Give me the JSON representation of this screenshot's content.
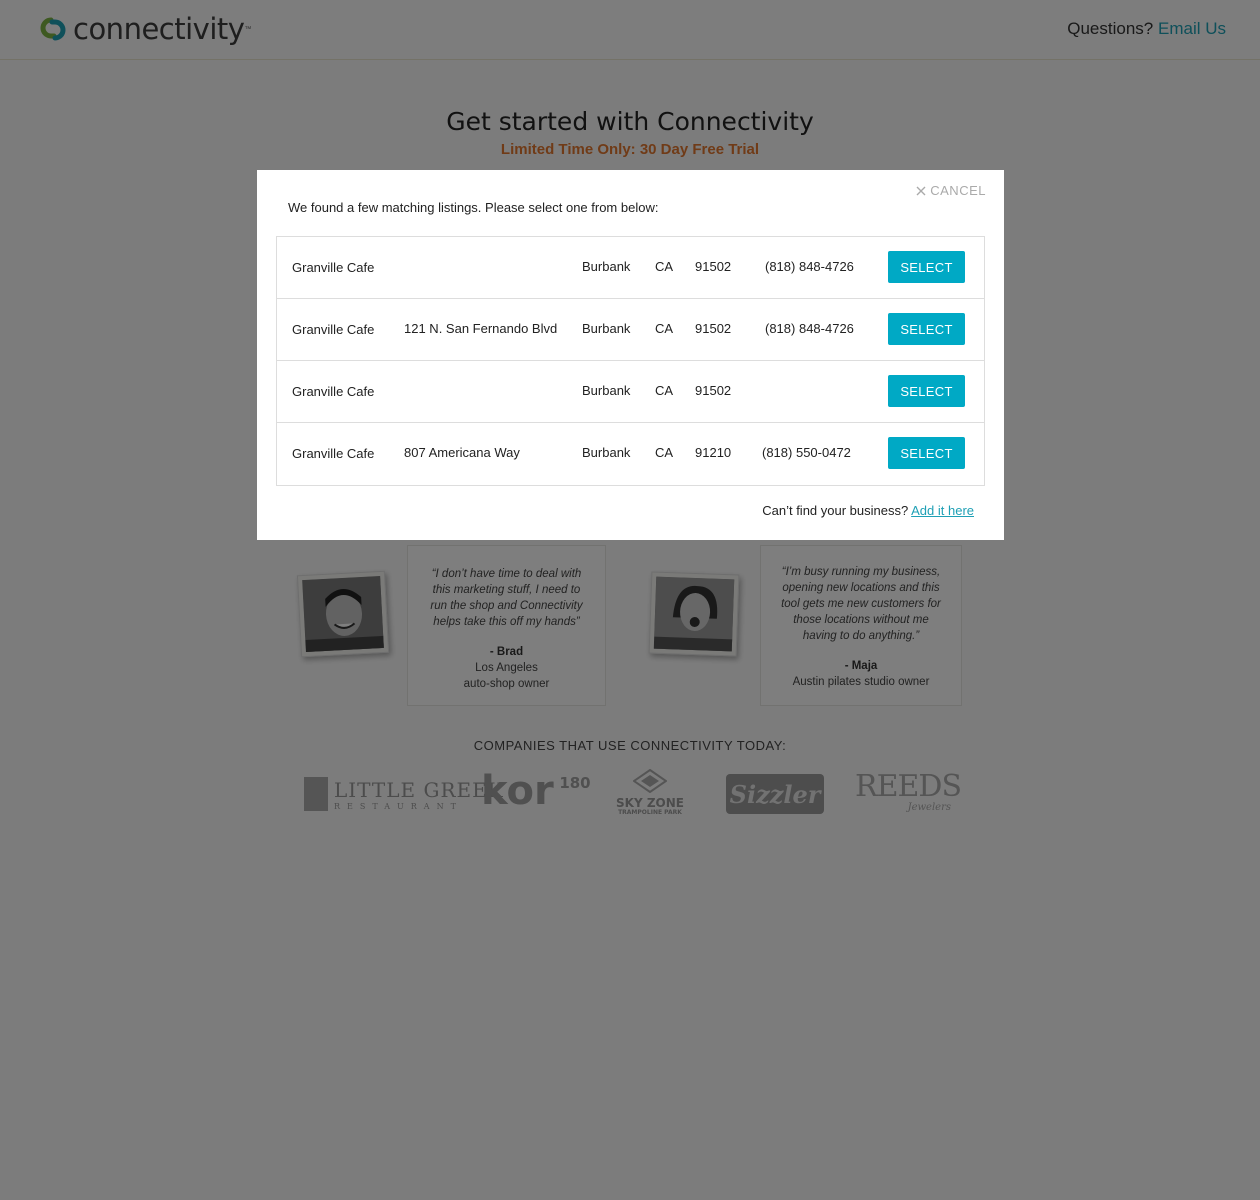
{
  "header": {
    "logo_text": "connectivity",
    "logo_tm": "™",
    "questions_label": "Questions?",
    "email_link": "Email Us"
  },
  "hero": {
    "title": "Get started with Connectivity",
    "subtitle": "Limited Time Only: 30 Day Free Trial"
  },
  "testimonials": [
    {
      "quote": "“I don’t have time to deal with this marketing stuff, I need to run the shop and Connectivity helps take this off my hands”",
      "name": "- Brad",
      "desc1": "Los Angeles",
      "desc2": "auto-shop owner"
    },
    {
      "quote": "“I’m busy running my business, opening new locations and this tool gets me new customers for those locations without me having to do anything.”",
      "name": "- Maja",
      "desc1": "Austin pilates studio owner",
      "desc2": ""
    }
  ],
  "companies": {
    "title": "COMPANIES THAT USE CONNECTIVITY TODAY:",
    "logos": [
      "LITTLE GREEK",
      "RESTAURANT",
      "kor",
      "180",
      "SKY ZONE",
      "TRAMPOLINE PARK",
      "Sizzler",
      "REEDS",
      "Jewelers"
    ]
  },
  "modal": {
    "cancel_label": "CANCEL",
    "intro": "We found a few matching listings. Please select one from below:",
    "select_label": "SELECT",
    "listings": [
      {
        "name": "Granville Cafe",
        "address": "",
        "city": "Burbank",
        "state": "CA",
        "zip": "91502",
        "phone": "(818) 848-4726"
      },
      {
        "name": "Granville Cafe",
        "address": "121 N. San Fernando Blvd",
        "city": "Burbank",
        "state": "CA",
        "zip": "91502",
        "phone": "(818) 848-4726"
      },
      {
        "name": "Granville Cafe",
        "address": "",
        "city": "Burbank",
        "state": "CA",
        "zip": "91502",
        "phone": ""
      },
      {
        "name": "Granville Cafe",
        "address": "807 Americana Way",
        "city": "Burbank",
        "state": "CA",
        "zip": "91210",
        "phone": "(818) 550-0472"
      }
    ],
    "cant_find": "Can’t find your business?",
    "add_link": "Add it here"
  },
  "colors": {
    "accent": "#00a9c5",
    "link": "#1fa0b5",
    "promo": "#e0762f"
  }
}
